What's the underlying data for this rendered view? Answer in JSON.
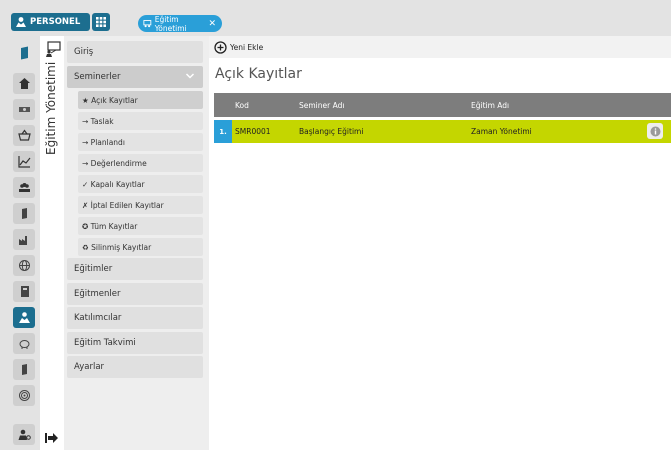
{
  "header": {
    "app_label": "PERSONEL",
    "tab_label": "Eğitim Yönetimi",
    "tab_close": "✕"
  },
  "module": {
    "title": "Eğitim Yönetimi"
  },
  "menu": {
    "items_top": [
      {
        "label": "Giriş"
      },
      {
        "label": "Seminerler"
      }
    ],
    "sub_items": [
      {
        "label": "★ Açık Kayıtlar"
      },
      {
        "label": "→ Taslak"
      },
      {
        "label": "→ Planlandı"
      },
      {
        "label": "→ Değerlendirme"
      },
      {
        "label": "✓ Kapalı Kayıtlar"
      },
      {
        "label": "✗ İptal Edilen Kayıtlar"
      },
      {
        "label": "✪ Tüm Kayıtlar"
      },
      {
        "label": "♻ Silinmiş Kayıtlar"
      }
    ],
    "items_bottom": [
      {
        "label": "Eğitimler"
      },
      {
        "label": "Eğitmenler"
      },
      {
        "label": "Katılımcılar"
      },
      {
        "label": "Eğitim Takvimi"
      },
      {
        "label": "Ayarlar"
      }
    ]
  },
  "content": {
    "add_label": "Yeni Ekle",
    "title": "Açık Kayıtlar",
    "columns": [
      "Kod",
      "Seminer Adı",
      "Eğitim Adı"
    ],
    "rows": [
      {
        "index": "1.",
        "kod": "SMR0001",
        "seminer": "Başlangıç Eğitimi",
        "egitim": "Zaman Yönetimi"
      }
    ]
  },
  "colors": {
    "brand": "#1c6e8f",
    "accent": "#2a9fd8",
    "row_highlight": "#c4d600"
  }
}
